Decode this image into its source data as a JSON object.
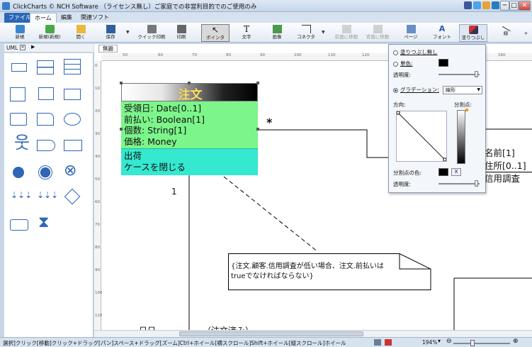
{
  "window": {
    "title": "ClickCharts © NCH Software （ライセンス無し）ご家庭での非営利目的でのご使用のみ",
    "buttons": {
      "minimize": "─",
      "maximize": "□",
      "close": "✕"
    }
  },
  "menu_tabs": [
    "ファイル",
    "ホーム",
    "編集",
    "関連ソフト"
  ],
  "ribbon": {
    "items": [
      {
        "label": "新規",
        "icon": "new-diagram-icon",
        "enabled": true
      },
      {
        "label": "新規(新規)",
        "icon": "new-from-template-icon",
        "enabled": true
      },
      {
        "label": "開く",
        "icon": "open-folder-icon",
        "enabled": true
      },
      {
        "label": "保存",
        "icon": "save-icon",
        "enabled": true
      },
      {
        "label": "クイック印刷",
        "icon": "quick-print-icon",
        "enabled": true
      },
      {
        "label": "印刷",
        "icon": "print-icon",
        "enabled": true
      },
      {
        "label": "ポインタ",
        "icon": "pointer-icon",
        "enabled": true,
        "active": true
      },
      {
        "label": "文字",
        "icon": "text-tool-icon",
        "enabled": true
      },
      {
        "label": "画像",
        "icon": "image-icon",
        "enabled": true
      },
      {
        "label": "コネクタ",
        "icon": "connector-icon",
        "enabled": true
      },
      {
        "label": "前面に移動",
        "icon": "bring-forward-icon",
        "enabled": false
      },
      {
        "label": "背面に移動",
        "icon": "send-backward-icon",
        "enabled": false
      },
      {
        "label": "ページ",
        "icon": "page-icon",
        "enabled": true
      },
      {
        "label": "フォント",
        "icon": "font-icon",
        "enabled": true
      },
      {
        "label": "塗りつぶし",
        "icon": "fill-bucket-icon",
        "enabled": true
      },
      {
        "label": "線",
        "icon": "line-icon",
        "enabled": true
      }
    ]
  },
  "left_panel": {
    "title": "UML",
    "shapes": [
      "rectangle",
      "table-2",
      "table-3",
      "note-document",
      "component",
      "package",
      "rounded-frame",
      "document-fold",
      "ellipse",
      "actor",
      "process",
      "banner",
      "filled-circle",
      "ring",
      "cross-circle",
      "fork",
      "fork-2",
      "decision",
      "rounded-rect",
      "hourglass"
    ]
  },
  "canvas": {
    "doc_tab": "無題",
    "ruler_h": [
      "50",
      "60",
      "70",
      "80",
      "90",
      "100",
      "110",
      "120",
      "130",
      "140",
      "150",
      "160"
    ],
    "ruler_v": [
      "0",
      "10",
      "20",
      "30",
      "40",
      "50",
      "60",
      "70",
      "80",
      "90",
      "100",
      "110"
    ],
    "class_box": {
      "name": "注文",
      "attributes": [
        "受領日: Date[0..1]",
        "前払い: Boolean[1]",
        "個数: String[1]",
        "価格: Money"
      ],
      "operations": [
        "出荷",
        "ケースを閉じる"
      ]
    },
    "multiplicity_star": "*",
    "multiplicity_one": "1",
    "note": "{注文.顧客.信用調査が低い場合、注文.前払いはtrueでなければならない}",
    "right_class_fragment": [
      "名前[1]",
      "住所[0..1]",
      "信用調査"
    ],
    "bottom_fragment_1": "日日",
    "bottom_fragment_2": "（注文済み）"
  },
  "fill_panel": {
    "no_fill": "塗りつぶし無し",
    "single_color": "単色:",
    "transparency": "透明度:",
    "gradient": "グラデーション:",
    "gradient_type": "線形",
    "direction": "方向:",
    "split_point": "分割点:",
    "split_color": "分割点の色:",
    "transparency2": "透明度:",
    "remove": "X",
    "color_primary": "#000000"
  },
  "status": {
    "text": "選択]クリック[移動]クリック+ドラッグ[パン]スペース+ドラッグ[ズーム]Ctrl+ホイール[横スクロール]Shift+ホイール[縦スクロール]ホイール",
    "zoom": "194%"
  }
}
